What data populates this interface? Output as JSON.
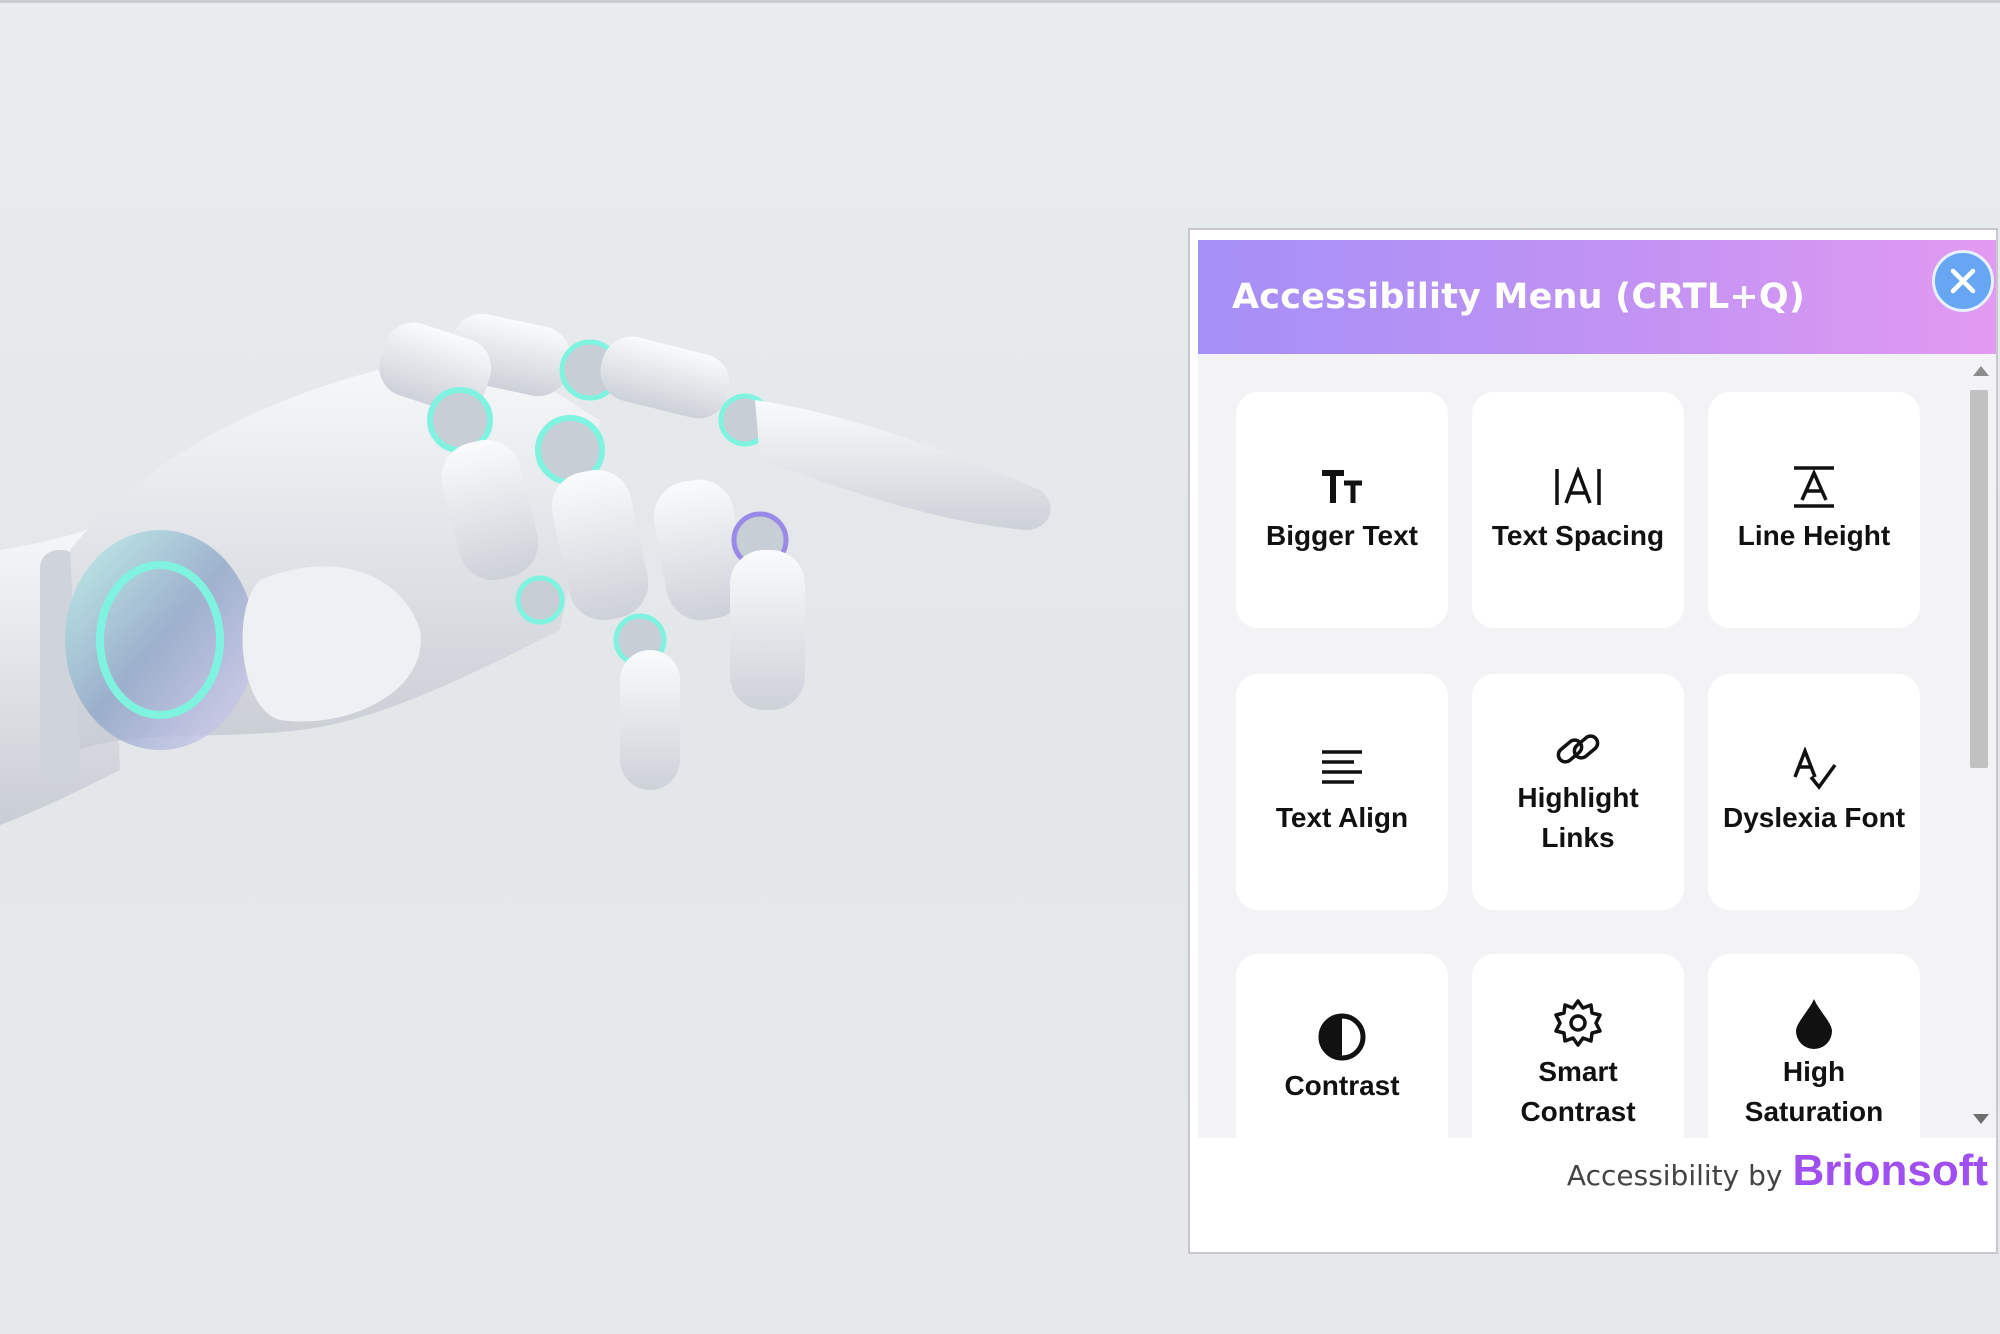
{
  "panel": {
    "title": "Accessibility Menu (CRTL+Q)",
    "close_icon": "close-icon",
    "tiles": [
      {
        "label": "Bigger Text",
        "icon": "bigger-text-icon"
      },
      {
        "label": "Text Spacing",
        "icon": "text-spacing-icon"
      },
      {
        "label": "Line Height",
        "icon": "line-height-icon"
      },
      {
        "label": "Text Align",
        "icon": "text-align-icon"
      },
      {
        "label": "Highlight Links",
        "icon": "link-icon"
      },
      {
        "label": "Dyslexia Font",
        "icon": "dyslexia-font-icon"
      },
      {
        "label": "Contrast",
        "icon": "contrast-icon"
      },
      {
        "label": "Smart Contrast",
        "icon": "gear-icon"
      },
      {
        "label": "High Saturation",
        "icon": "droplet-icon"
      }
    ],
    "footer": {
      "prefix": "Accessibility by",
      "brand": "Brionsoft"
    }
  },
  "colors": {
    "header_gradient_start": "#a590f7",
    "header_gradient_end": "#e29af2",
    "close_button": "#67a6f2",
    "brand": "#a04ff0"
  }
}
